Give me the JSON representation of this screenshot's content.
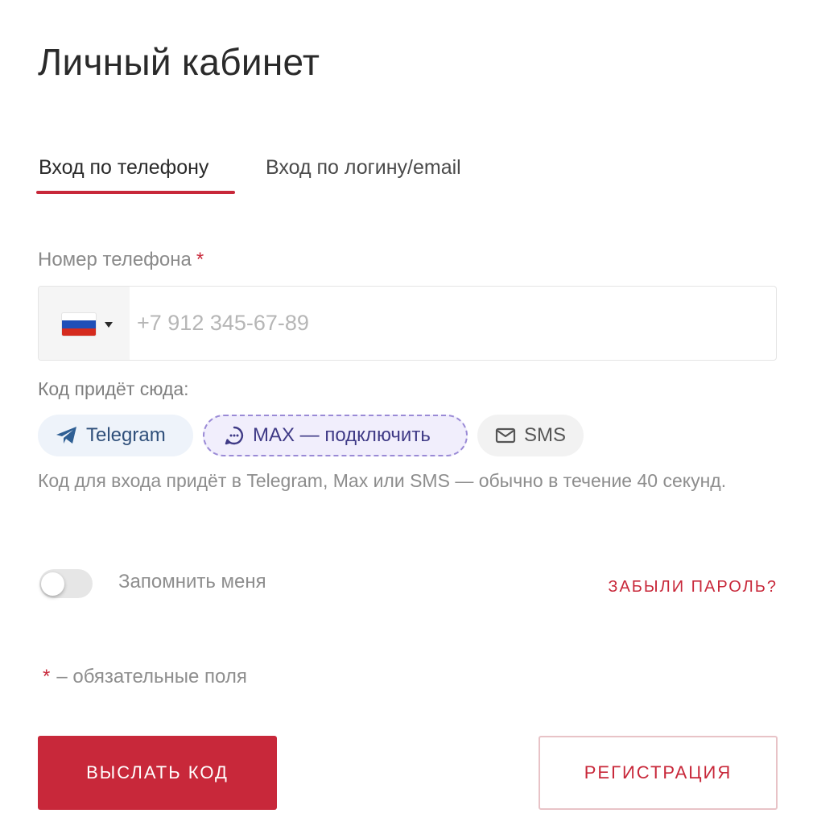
{
  "page": {
    "title": "Личный кабинет"
  },
  "tabs": [
    {
      "label": "Вход по телефону",
      "active": true
    },
    {
      "label": "Вход по логину/email",
      "active": false
    }
  ],
  "phone": {
    "label": "Номер телефона",
    "required_mark": "*",
    "placeholder": "+7 912 345-67-89",
    "value": "",
    "country_flag": "russia-flag-icon",
    "flag_colors": [
      "#ffffff",
      "#1f4fb8",
      "#d52b1e"
    ]
  },
  "channels": {
    "label": "Код придёт сюда:",
    "options": [
      {
        "label": "Telegram",
        "icon": "telegram-icon"
      },
      {
        "label": "MAX — подключить",
        "icon": "max-icon"
      },
      {
        "label": "SMS",
        "icon": "mail-icon"
      }
    ],
    "hint": "Код для входа придёт в Telegram, Max или SMS — обычно в течение 40 секунд."
  },
  "remember": {
    "label": "Запомнить меня",
    "checked": false
  },
  "forgot": {
    "label": "ЗАБЫЛИ ПАРОЛЬ?"
  },
  "required_note": {
    "mark": "*",
    "text": "– обязательные поля"
  },
  "actions": {
    "send_label": "ВЫСЛАТЬ КОД",
    "register_label": "РЕГИСТРАЦИЯ"
  },
  "colors": {
    "accent": "#c8283a",
    "max_border": "#9a8ad6",
    "telegram": "#2f5f94"
  }
}
